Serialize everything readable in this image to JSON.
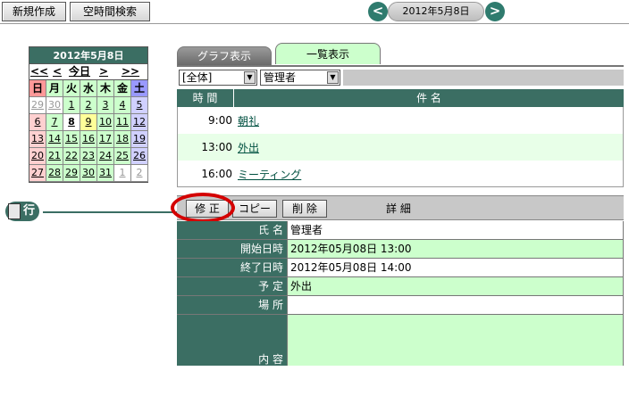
{
  "toolbar": {
    "new_label": "新規作成",
    "search_label": "空時間検索",
    "prev_symbol": "<",
    "next_symbol": ">",
    "current_date": "2012年5月8日"
  },
  "calendar": {
    "title": "2012年5月8日",
    "nav": [
      "<<",
      "<",
      "今日",
      ">",
      ">>"
    ],
    "weekdays": [
      "日",
      "月",
      "火",
      "水",
      "木",
      "金",
      "土"
    ],
    "weeks": [
      [
        "29",
        "30",
        "1",
        "2",
        "3",
        "4",
        "5"
      ],
      [
        "6",
        "7",
        "8",
        "9",
        "10",
        "11",
        "12"
      ],
      [
        "13",
        "14",
        "15",
        "16",
        "17",
        "18",
        "19"
      ],
      [
        "20",
        "21",
        "22",
        "23",
        "24",
        "25",
        "26"
      ],
      [
        "27",
        "28",
        "29",
        "30",
        "31",
        "1",
        "2"
      ]
    ],
    "selected_day": "8"
  },
  "logo": {
    "text": "行事予定"
  },
  "tabs": {
    "graph": "グラフ表示",
    "list": "一覧表示",
    "active": "list"
  },
  "filters": {
    "group": "[全体]",
    "user": "管理者"
  },
  "list": {
    "col_time": "時 間",
    "col_subject": "件 名",
    "rows": [
      {
        "time": "9:00",
        "subject": "朝礼"
      },
      {
        "time": "13:00",
        "subject": "外出"
      },
      {
        "time": "16:00",
        "subject": "ミーティング"
      }
    ]
  },
  "detail": {
    "edit_label": "修 正",
    "copy_label": "コピー",
    "delete_label": "削 除",
    "header": "詳 細",
    "fields": [
      {
        "key": "氏 名",
        "value": "管理者"
      },
      {
        "key": "開始日時",
        "value": "2012年05月08日 13:00"
      },
      {
        "key": "終了日時",
        "value": "2012年05月08日 14:00"
      },
      {
        "key": "予 定",
        "value": "外出"
      },
      {
        "key": "場 所",
        "value": ""
      },
      {
        "key": "内 容",
        "value": ""
      }
    ]
  },
  "colors": {
    "header_green": "#3b6e63",
    "row_green": "#ccffcc",
    "highlight_red": "#d40000"
  }
}
